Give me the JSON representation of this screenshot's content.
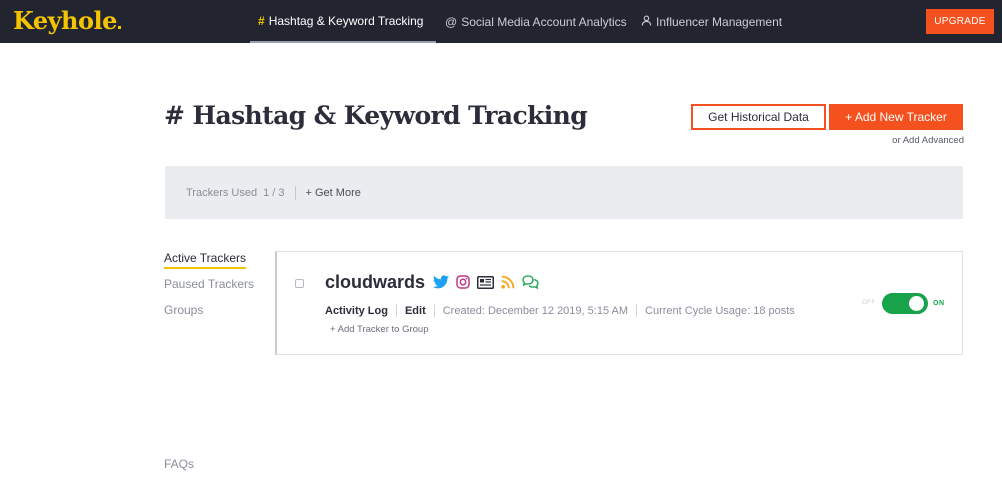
{
  "app": {
    "logo": "Keyhole"
  },
  "nav": {
    "tabs": [
      {
        "icon": "#",
        "label": "Hashtag & Keyword Tracking",
        "active": true
      },
      {
        "icon": "@",
        "label": "Social Media Account Analytics",
        "active": false
      },
      {
        "icon": "person-icon",
        "label": "Influencer Management",
        "active": false
      }
    ],
    "upgrade_label": "UPGRADE"
  },
  "header": {
    "title": "# Hashtag & Keyword Tracking",
    "historical_label": "Get Historical Data",
    "add_label": "+ Add New Tracker",
    "add_advanced": "or Add Advanced"
  },
  "usage": {
    "label": "Trackers Used",
    "count": "1 / 3",
    "get_more": "+ Get More"
  },
  "sidebar": {
    "items": [
      {
        "label": "Active Trackers",
        "active": true
      },
      {
        "label": "Paused Trackers",
        "active": false
      },
      {
        "label": "Groups",
        "active": false
      }
    ],
    "faqs": "FAQs"
  },
  "tracker": {
    "name": "cloudwards",
    "platforms": [
      "twitter-icon",
      "instagram-icon",
      "news-icon",
      "rss-icon",
      "forum-icon"
    ],
    "activity_log": "Activity Log",
    "edit": "Edit",
    "created": "Created: December 12 2019, 5:15 AM",
    "usage": "Current Cycle Usage: 18 posts",
    "add_to_group": "+ Add Tracker to Group",
    "toggle_off": "OFF",
    "toggle_on": "ON",
    "enabled": true
  },
  "colors": {
    "accent": "#f4511e",
    "brand": "#f5c400",
    "navbar": "#22252f",
    "toggle_on": "#16a34a",
    "twitter": "#1da1f2",
    "instagram": "#c13584",
    "rss": "#f7a21b",
    "forum": "#16a34a"
  }
}
